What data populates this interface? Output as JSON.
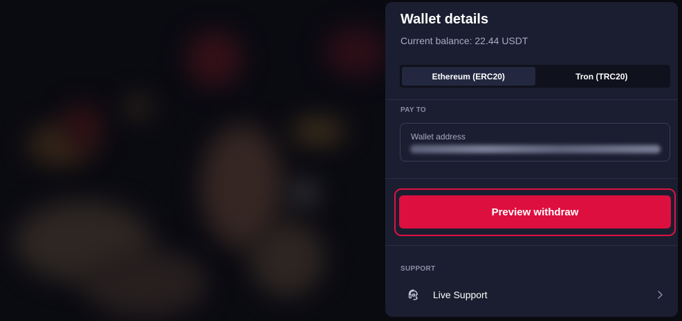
{
  "panel": {
    "title": "Wallet details",
    "balance": "Current balance: 22.44 USDT",
    "networks": [
      {
        "label": "Ethereum (ERC20)",
        "active": true
      },
      {
        "label": "Tron (TRC20)",
        "active": false
      }
    ],
    "pay_to_label": "PAY TO",
    "wallet_field_label": "Wallet address",
    "preview_button": "Preview withdraw",
    "support_heading": "SUPPORT",
    "support_item": "Live Support"
  },
  "icons": {
    "support": "headset-icon",
    "chevron": "chevron-right-icon"
  },
  "colors": {
    "panel_bg": "#1b1e30",
    "accent": "#dd0f3f",
    "muted_text": "#a7acc2"
  }
}
